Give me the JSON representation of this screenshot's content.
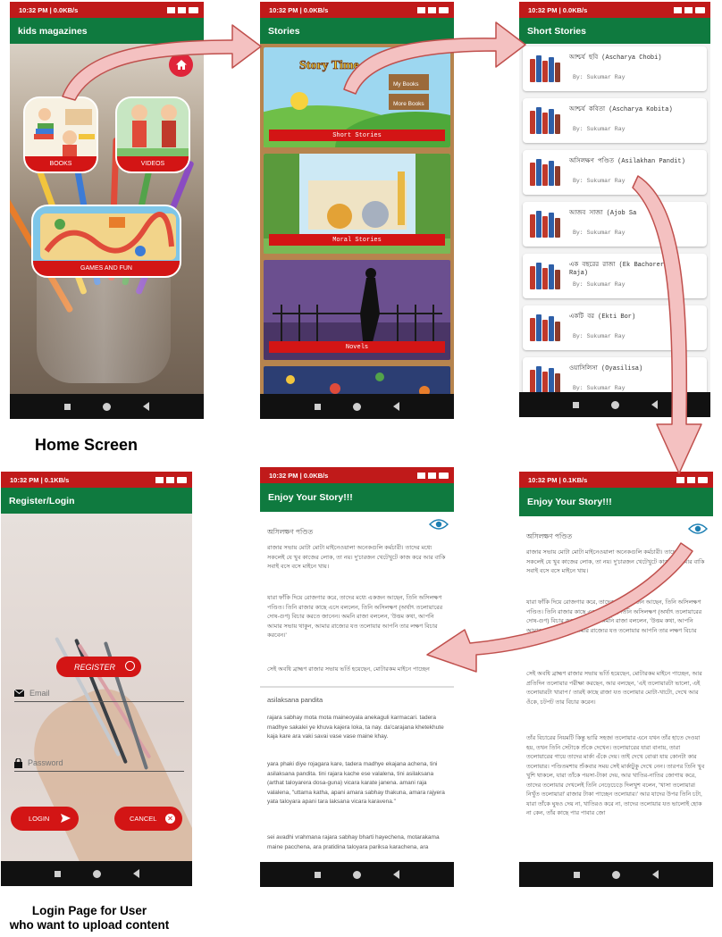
{
  "captions": {
    "home": "Home Screen",
    "login_line1": "Login Page for User",
    "login_line2": "who want to upload content"
  },
  "status": {
    "p1": "10:32 PM | 0.0KB/s",
    "p2": "10:32 PM | 0.0KB/s",
    "p3": "10:32 PM | 0.0KB/s",
    "p4": "10:32 PM | 0.1KB/s",
    "p5": "10:32 PM | 0.0KB/s",
    "p6": "10:32 PM | 0.1KB/s"
  },
  "home": {
    "title": "kids magazines",
    "tiles": {
      "books": "BOOKS",
      "videos": "VIDEOS",
      "games": "GAMES AND FUN"
    }
  },
  "stories": {
    "title": "Stories",
    "cards": [
      "Short Stories",
      "Moral Stories",
      "Novels"
    ],
    "banner": {
      "title": "Story Time",
      "sign1": "My Books",
      "sign2": "More Books"
    }
  },
  "short_stories": {
    "title": "Short Stories",
    "items": [
      {
        "title": "আশ্চর্য ছবি (Ascharya Chobi)",
        "author": "By: Sukumar Ray"
      },
      {
        "title": "আশ্চর্য কবিতা (Ascharya Kobita)",
        "author": "By: Sukumar Ray"
      },
      {
        "title": "অসিলক্ষণ পণ্ডিত (Asilakhan Pandit)",
        "author": "By: Sukumar Ray"
      },
      {
        "title": "আজব সাজা (Ajob Sa",
        "author": "By: Sukumar Ray"
      },
      {
        "title": "এক বছরের রাজা (Ek Bachorer Raja)",
        "author": "By: Sukumar Ray"
      },
      {
        "title": "একটি বর (Ekti Bor)",
        "author": "By: Sukumar Ray"
      },
      {
        "title": "ওয়াসিলিসা (Oyasilisa)",
        "author": "By: Sukumar Ray"
      }
    ]
  },
  "login": {
    "title": "Register/Login",
    "register": "REGISTER",
    "email_placeholder": "Email",
    "password_placeholder": "Password",
    "login_btn": "LOGIN",
    "cancel_btn": "CANCEL"
  },
  "story_a": {
    "title": "Enjoy Your Story!!!",
    "story_title": "অসিলক্ষণ পণ্ডিত",
    "paras": [
      "রাজার সভায় মোটা মোটা মাইনেওয়ালা অনেকগুলি কর্মচারী। তাদের মধ্যে সকলেই যে খুব কাজের লোক, তা নয়। দু'চারজন খেটেখুটে কাজ করে আর বাকি সবাই বসে বসে মাইনে খায়।",
      "যারা ফাঁকি দিয়ে রোজগার করে, তাদের মধ্যে একজন আছেন, তিনি অসিলক্ষণ পণ্ডিত। তিনি রাজার কাছে এসে বললেন, তিনি অসিলক্ষণ (অর্থাৎ তলোয়ারের দোষ-গুণ) বিচার করতে জানেন। অমনি রাজা বললেন, 'উত্তম কথা, আপনি আমার সভায় থাকুন, আমার রাজ্যের যত তলোয়ার আপনি তার লক্ষণ বিচার করবেন।'",
      "সেই অবধি ব্রাহ্মণ রাজার সভায় ভর্তি হয়েছেন, মোটারকম মাইনে পাচ্ছেন"
    ],
    "translit_title": "asilaksana pandita",
    "translit": [
      "rajara sabhay mota mota maineoyala anekaguli karmacari. tadera madhye sakalei ye khuva kajera loka, ta nay. da'carajana khetekhute kaja kare ara vaki savai vase vase maine khay.",
      "yara phaki diye rojagara kare, tadera madhye ekajana achena, tini asilaksana pandita. tini rajara kache ese valalena, tini asilaksana (arthat taloyarera dosa-guna) vicara karate janena. amani raja valalena, \"uttama katha, apani amara sabhay thakuna, amara rajyera yata taloyara apani tara laksana vicara karavena.\"",
      "sei avadhi vrahmana rajara sabhay bharti hayechena, motarakama maine pacchena, ara pratidina taloyara pariksa karachena, ara"
    ]
  },
  "story_b": {
    "title": "Enjoy Your Story!!!",
    "story_title": "অসিলক্ষণ পণ্ডিত",
    "paras": [
      "রাজার সভায় মোটা মোটা মাইনেওয়ালা অনেকগুলি কর্মচারী। তাদের মধ্যে সকলেই যে খুব কাজের লোক, তা নয়। দু'চারজন খেটেখুটে কাজ করে আর বাকি সবাই বসে বসে মাইনে খায়।",
      "যারা ফাঁকি দিয়ে রোজগার করে, তাদের মধ্যে একজন আছেন, তিনি অসিলক্ষণ পণ্ডিত। তিনি রাজার কাছে এসে বললেন, তিনি অসিলক্ষণ (অর্থাৎ তলোয়ারের দোষ-গুণ) বিচার করতে জানেন। অমনি রাজা বললেন, 'উত্তম কথা, আপনি আমার সভায় থাকুন, আমার রাজ্যের যত তলোয়ার আপনি তার লক্ষণ বিচার করবেন।'",
      "সেই অবধি ব্রাহ্মণ রাজার সভায় ভর্তি হয়েছেন, মোটারকম মাইনে পাচ্ছেন, আর প্রতিদিন তলোয়ার পরীক্ষা করছেন, আর বলছেন, 'এই তলোয়ারটা ভালো, এই তলোয়ারটা খারাপ।' তারই কাছে রাজা যত তলোয়ার মোটা-খাটো, দেখে আর ওঁকে, চটপট তার বিচার করেন।",
      "তাঁর বিচারের নিয়মটি কিন্তু ভারি সহজ! তলোয়ার এনে যখন তাঁর হাতে দেওয়া হয়, তখন তিনি সেটাকে শুঁকে দেখেন। তলোয়ারের যারা বানায়, তারা তলোয়ারের গায়ে তাদের মার্কা এঁকে দেয়। তাই দেখে বোঝা যায় কোনটা কার তলোয়ার। পণ্ডিতমশায় শুঁকবার সময় সেই মার্কাটুকু দেখে নেন। তারপর তিনি খুব খুশি থাকলে, যারা তাঁকে পয়সা-টাকা দেয়, আর খাতির-নাতির জোগায় করে, তাদের তলোয়ার দেখলেই তিনি নেড়েচেড়ে দিলখুশ বলেন, 'খাসা তলোয়ার! নিখুঁত তলোয়ার!' রাজার টাকা পাচ্ছেন তলোয়ার।' আর যাদের উপর তিনি চটা, যারা তাঁকে ঘুষও দেয় না, খাতিরও করে না, তাদের তলোয়ার যত ভালোই হোক না কেন, তাঁর কাছে পার পাবার জো"
    ]
  }
}
